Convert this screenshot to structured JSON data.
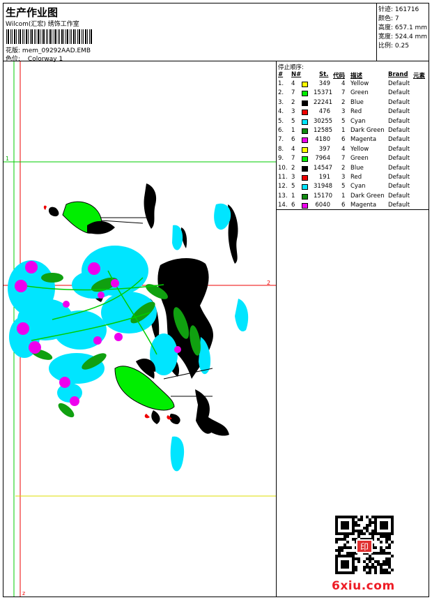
{
  "header": {
    "title": "生产作业图",
    "subtitle": "Wilcom(汇宏) 绣饰工作室",
    "design_label": "花版:",
    "design_value": "mem_09292AAD.EMB",
    "colorway_label": "色位:",
    "colorway_value": "Colorway 1"
  },
  "specs": {
    "stitches_label": "针迹:",
    "stitches_value": "161716",
    "colors_label": "颜色:",
    "colors_value": "7",
    "height_label": "高度:",
    "height_value": "657.1 mm",
    "width_label": "宽度:",
    "width_value": "524.4 mm",
    "scale_label": "比例:",
    "scale_value": "0.25"
  },
  "stop_sequence": {
    "title": "停止顺序:",
    "headers": {
      "num": "#",
      "needle": "N#",
      "stitches": "St.",
      "code": "代码",
      "desc": "描述",
      "brand": "Brand",
      "element": "元素"
    },
    "rows": [
      {
        "num": "1.",
        "needle": "4",
        "stitches": "349",
        "code": "4",
        "desc": "Yellow",
        "brand": "Default",
        "color": "#ffff00"
      },
      {
        "num": "2.",
        "needle": "7",
        "stitches": "15371",
        "code": "7",
        "desc": "Green",
        "brand": "Default",
        "color": "#00ee00"
      },
      {
        "num": "3.",
        "needle": "2",
        "stitches": "22241",
        "code": "2",
        "desc": "Blue",
        "brand": "Default",
        "color": "#000000"
      },
      {
        "num": "4.",
        "needle": "3",
        "stitches": "476",
        "code": "3",
        "desc": "Red",
        "brand": "Default",
        "color": "#ee0000"
      },
      {
        "num": "5.",
        "needle": "5",
        "stitches": "30255",
        "code": "5",
        "desc": "Cyan",
        "brand": "Default",
        "color": "#00e5ff"
      },
      {
        "num": "6.",
        "needle": "1",
        "stitches": "12585",
        "code": "1",
        "desc": "Dark Green",
        "brand": "Default",
        "color": "#108a10"
      },
      {
        "num": "7.",
        "needle": "6",
        "stitches": "4180",
        "code": "6",
        "desc": "Magenta",
        "brand": "Default",
        "color": "#ee00ee"
      },
      {
        "num": "8.",
        "needle": "4",
        "stitches": "397",
        "code": "4",
        "desc": "Yellow",
        "brand": "Default",
        "color": "#ffff00"
      },
      {
        "num": "9.",
        "needle": "7",
        "stitches": "7964",
        "code": "7",
        "desc": "Green",
        "brand": "Default",
        "color": "#00ee00"
      },
      {
        "num": "10.",
        "needle": "2",
        "stitches": "14547",
        "code": "2",
        "desc": "Blue",
        "brand": "Default",
        "color": "#000000"
      },
      {
        "num": "11.",
        "needle": "3",
        "stitches": "191",
        "code": "3",
        "desc": "Red",
        "brand": "Default",
        "color": "#ee0000"
      },
      {
        "num": "12.",
        "needle": "5",
        "stitches": "31948",
        "code": "5",
        "desc": "Cyan",
        "brand": "Default",
        "color": "#00e5ff"
      },
      {
        "num": "13.",
        "needle": "1",
        "stitches": "15170",
        "code": "1",
        "desc": "Dark Green",
        "brand": "Default",
        "color": "#108a10"
      },
      {
        "num": "14.",
        "needle": "6",
        "stitches": "6040",
        "code": "6",
        "desc": "Magenta",
        "brand": "Default",
        "color": "#ee00ee"
      }
    ]
  },
  "design_markers": {
    "marker_1": "1",
    "marker_2": "2",
    "marker_z": "z"
  },
  "watermark": "6xiu.com",
  "seal_text": "印"
}
